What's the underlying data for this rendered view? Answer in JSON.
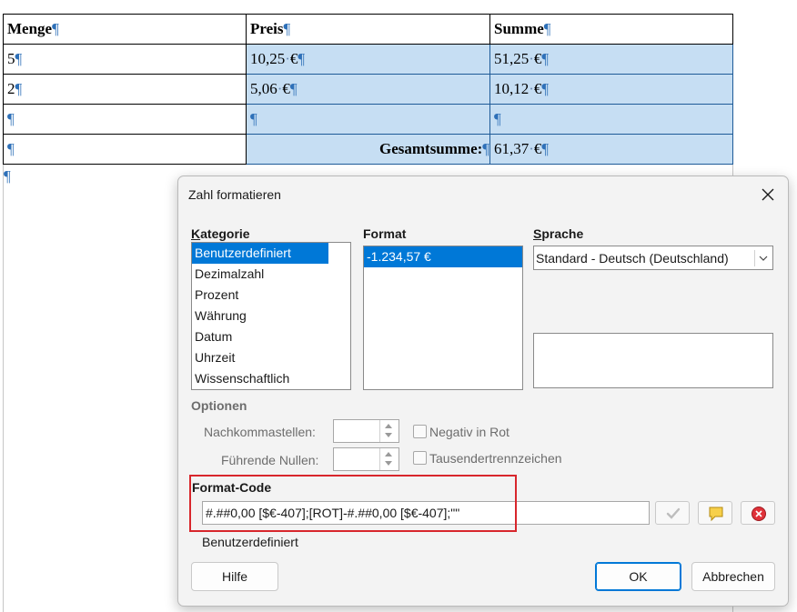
{
  "document": {
    "table": {
      "headers": [
        "Menge",
        "Preis",
        "Summe"
      ],
      "rows": [
        [
          "5",
          "10,25",
          "51,25"
        ],
        [
          "2",
          "5,06",
          "10,12"
        ],
        [
          "",
          "",
          ""
        ]
      ],
      "currency": "€",
      "total_label": "Gesamtsumme:",
      "total_value": "61,37",
      "para_mark": "¶",
      "space_dot": "·"
    }
  },
  "dialog": {
    "title": "Zahl formatieren",
    "kategorie": {
      "label": "Kategorie",
      "items": [
        "Benutzerdefiniert",
        "Dezimalzahl",
        "Prozent",
        "Währung",
        "Datum",
        "Uhrzeit",
        "Wissenschaftlich"
      ],
      "selected": "Benutzerdefiniert"
    },
    "format": {
      "label": "Format",
      "items": [
        "-1.234,57 €"
      ]
    },
    "sprache": {
      "label": "Sprache",
      "value": "Standard - Deutsch (Deutschland)"
    },
    "optionen": {
      "label": "Optionen",
      "nachkommastellen_label": "Nachkommastellen:",
      "fuehrende_nullen_label": "Führende Nullen:",
      "negativ_rot_label": "Negativ in Rot",
      "tausender_label": "Tausendertrennzeichen"
    },
    "format_code": {
      "label": "Format-Code",
      "value": "#.##0,00 [$€-407];[ROT]-#.##0,00 [$€-407];\"\"",
      "description": "Benutzerdefiniert"
    },
    "buttons": {
      "help": "Hilfe",
      "ok": "OK",
      "cancel": "Abbrechen"
    }
  }
}
